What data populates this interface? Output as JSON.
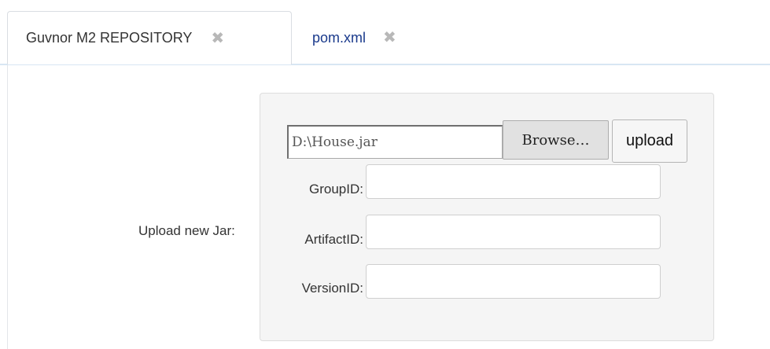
{
  "tabs": [
    {
      "label": "Guvnor M2 REPOSITORY",
      "close_glyph": "✖",
      "active": true
    },
    {
      "label": "pom.xml",
      "close_glyph": "✖",
      "active": false
    }
  ],
  "form": {
    "upload_label": "Upload new Jar:",
    "file_value": "D:\\House.jar",
    "browse_label": "Browse…",
    "upload_button": "upload",
    "group_label": "GroupID:",
    "group_value": "",
    "artifact_label": "ArtifactID:",
    "artifact_value": "",
    "version_label": "VersionID:",
    "version_value": ""
  },
  "colors": {
    "tab_inactive_text": "#1a3a8c",
    "panel_bg": "#f5f5f5",
    "tab_underline": "#d8e6f3"
  },
  "icons": {
    "tab_close": "close-icon"
  }
}
